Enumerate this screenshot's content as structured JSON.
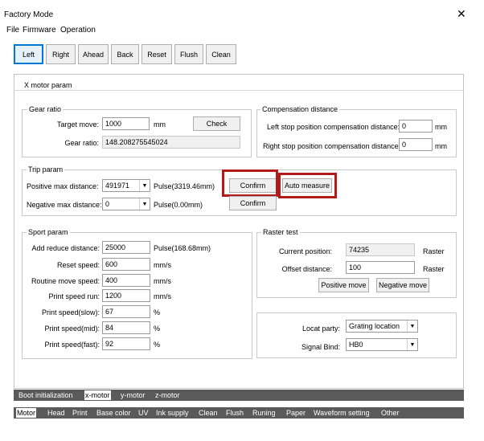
{
  "window": {
    "title": "Factory Mode",
    "close_glyph": "✕"
  },
  "menu": [
    "File",
    "Firmware",
    "Operation"
  ],
  "toolbar": {
    "buttons": [
      "Left",
      "Right",
      "Ahead",
      "Back",
      "Reset",
      "Flush",
      "Clean"
    ],
    "active": "Left"
  },
  "panel_title": "X motor param",
  "gear": {
    "title": "Gear ratio",
    "target_move_label": "Target move:",
    "target_move_value": "1000",
    "target_move_unit": "mm",
    "check_label": "Check",
    "gear_ratio_label": "Gear ratio:",
    "gear_ratio_value": "148.208275545024"
  },
  "compensation": {
    "title": "Compensation distance",
    "left_label": "Left stop position compensation distance:",
    "left_value": "0",
    "left_unit": "mm",
    "right_label": "Right stop position compensation distance:",
    "right_value": "0",
    "right_unit": "mm"
  },
  "trip": {
    "title": "Trip param",
    "pos_label": "Positive max distance:",
    "pos_value": "491971",
    "pos_unit": "Pulse(3319.46mm)",
    "neg_label": "Negative max distance:",
    "neg_value": "0",
    "neg_unit": "Pulse(0.00mm)",
    "confirm1": "Confirm",
    "confirm2": "Confirm",
    "auto_measure": "Auto measure"
  },
  "sport": {
    "title": "Sport param",
    "rows": [
      {
        "label": "Add reduce distance:",
        "value": "25000",
        "unit": "Pulse(168.68mm)"
      },
      {
        "label": "Reset speed:",
        "value": "600",
        "unit": "mm/s"
      },
      {
        "label": "Routine move speed:",
        "value": "400",
        "unit": "mm/s"
      },
      {
        "label": "Print speed run:",
        "value": "1200",
        "unit": "mm/s"
      },
      {
        "label": "Print speed(slow):",
        "value": "67",
        "unit": "%"
      },
      {
        "label": "Print speed(mid):",
        "value": "84",
        "unit": "%"
      },
      {
        "label": "Print speed(fast):",
        "value": "92",
        "unit": "%"
      }
    ]
  },
  "raster": {
    "title": "Raster test",
    "current_label": "Current position:",
    "current_value": "74235",
    "current_unit": "Raster",
    "offset_label": "Offset distance:",
    "offset_value": "100",
    "offset_unit": "Raster",
    "positive_move": "Positive move",
    "negative_move": "Negative move"
  },
  "locat": {
    "party_label": "Locat party:",
    "party_value": "Grating location",
    "signal_label": "Signal Bind:",
    "signal_value": "HB0"
  },
  "subtabs": {
    "items": [
      "Boot initialization",
      "x-motor",
      "y-motor",
      "z-motor"
    ],
    "active": "x-motor"
  },
  "maintabs": {
    "items": [
      "Motor",
      "Head",
      "Print",
      "Base color",
      "UV",
      "Ink supply",
      "Clean",
      "Flush",
      "Runing",
      "Paper",
      "Waveform setting",
      "Other"
    ],
    "active": "Motor"
  },
  "colors": {
    "highlight": "#b31b1b",
    "active_border": "#0078d7",
    "tabstrip": "#5a5a5a"
  }
}
